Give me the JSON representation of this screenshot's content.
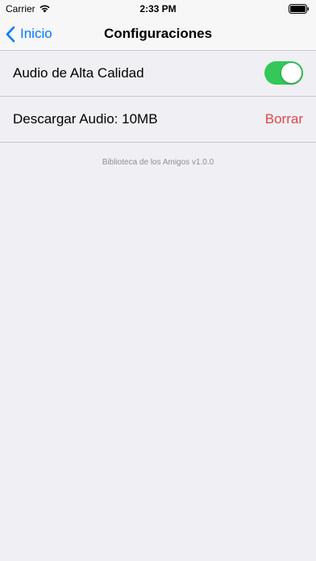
{
  "status_bar": {
    "carrier": "Carrier",
    "time": "2:33 PM",
    "wifi_icon": "wifi-icon",
    "battery_icon": "battery-icon"
  },
  "nav": {
    "back_label": "Inicio",
    "back_icon": "chevron-left-icon",
    "title": "Configuraciones",
    "accent_color": "#007aff"
  },
  "settings": {
    "high_quality_audio": {
      "label": "Audio de Alta Calidad",
      "enabled": true,
      "toggle_color": "#34c759"
    },
    "downloaded_audio": {
      "label": "Descargar Audio: 10MB",
      "action_label": "Borrar",
      "action_color": "#e0474c"
    }
  },
  "footer": {
    "version_text": "Biblioteca de los Amigos v1.0.0"
  }
}
